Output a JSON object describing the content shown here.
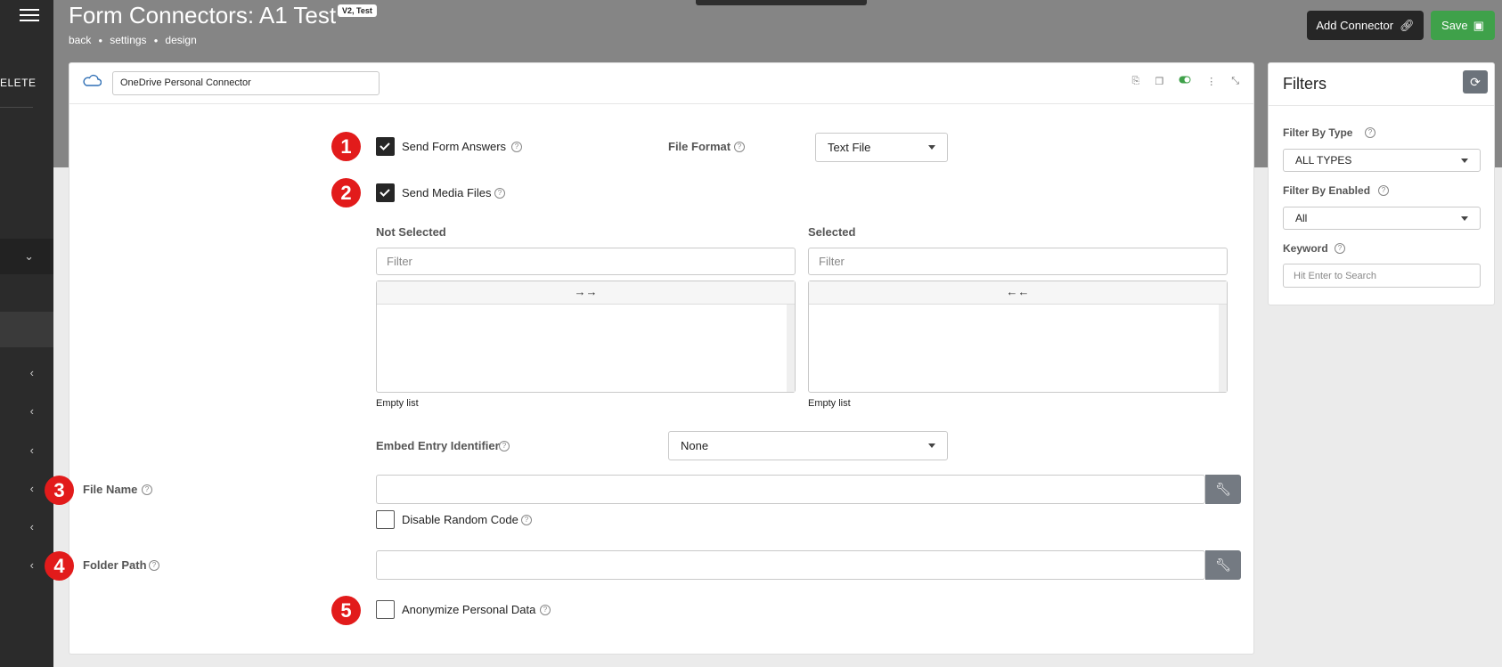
{
  "sidebar": {
    "delete_label": "ELETE"
  },
  "header": {
    "title": "Form Connectors: A1 Test",
    "badge": "V2, Test",
    "crumbs": [
      "back",
      "settings",
      "design"
    ],
    "add_connector_label": "Add Connector",
    "save_label": "Save"
  },
  "connector": {
    "name": "OneDrive Personal Connector"
  },
  "form": {
    "markers": [
      "1",
      "2",
      "3",
      "4",
      "5"
    ],
    "send_form_answers": {
      "label": "Send Form Answers",
      "checked": true
    },
    "file_format": {
      "label": "File Format",
      "value": "Text File"
    },
    "send_media_files": {
      "label": "Send Media Files",
      "checked": true
    },
    "not_selected": {
      "label": "Not Selected",
      "filter_placeholder": "Filter",
      "move_label": "→→",
      "status": "Empty list"
    },
    "selected": {
      "label": "Selected",
      "filter_placeholder": "Filter",
      "move_label": "←←",
      "status": "Empty list"
    },
    "embed_entry_identifier": {
      "label": "Embed Entry Identifier",
      "value": "None"
    },
    "file_name": {
      "label": "File Name",
      "value": ""
    },
    "disable_random_code": {
      "label": "Disable Random Code",
      "checked": false
    },
    "folder_path": {
      "label": "Folder Path",
      "value": ""
    },
    "anonymize_personal_data": {
      "label": "Anonymize Personal Data",
      "checked": false
    }
  },
  "filters": {
    "title": "Filters",
    "by_type": {
      "label": "Filter By Type",
      "value": "ALL TYPES"
    },
    "by_enabled": {
      "label": "Filter By Enabled",
      "value": "All"
    },
    "keyword": {
      "label": "Keyword",
      "placeholder": "Hit Enter to Search"
    }
  },
  "colors": {
    "accent_green": "#3fa14a",
    "marker_red": "#e21b1b",
    "sidebar": "#2b2b2b",
    "header_gray": "#858585"
  }
}
